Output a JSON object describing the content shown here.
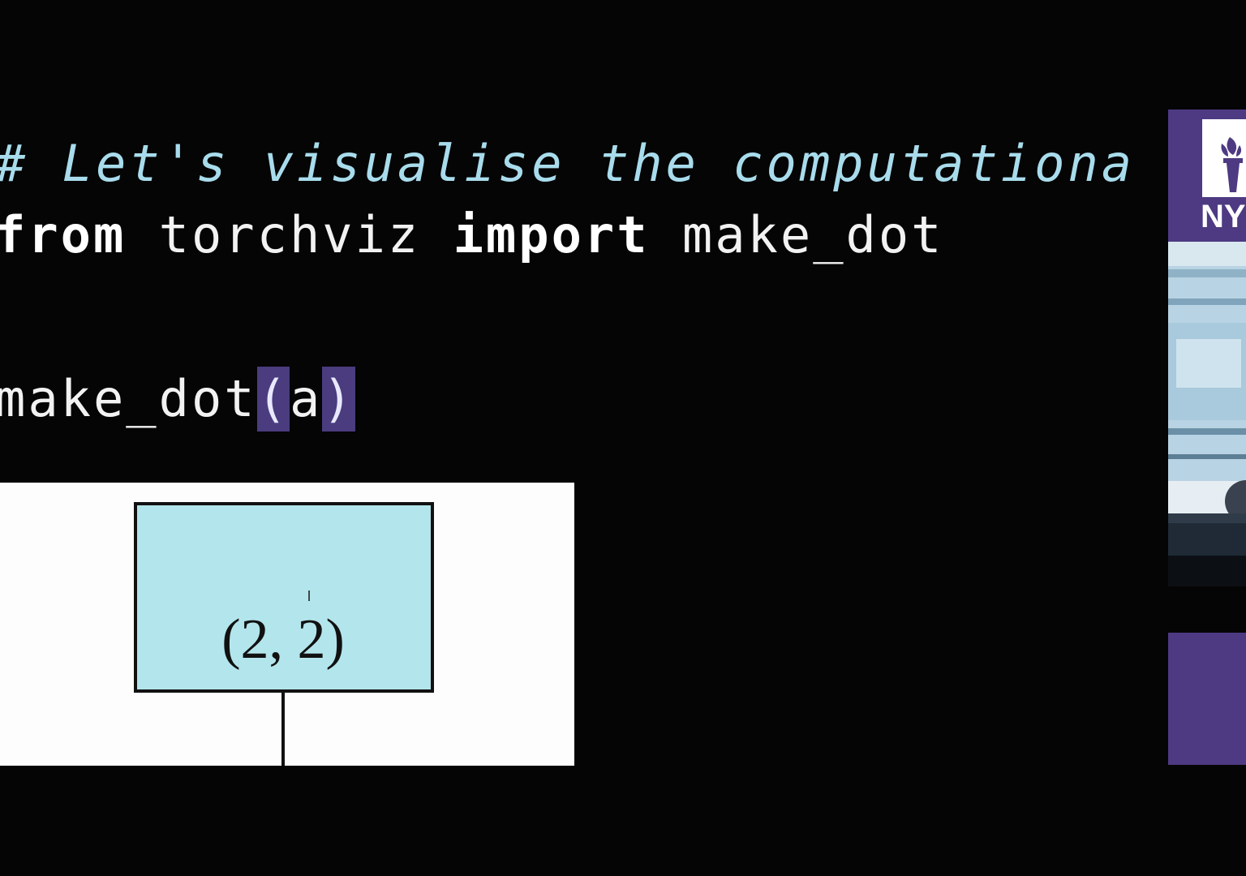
{
  "code": {
    "comment": "# Let's visualise the computationa",
    "import_line": {
      "kw_from": "from",
      "module": " torchviz ",
      "kw_import": "import",
      "name": " make_dot"
    },
    "call_line": {
      "func": "make_dot",
      "open_paren": "(",
      "arg": "a",
      "close_paren": ")"
    }
  },
  "graph": {
    "node_label": "(2, 2)",
    "node_fill": "#b3e5ec"
  },
  "sidebar": {
    "logo_text": "NY"
  },
  "colors": {
    "background": "#050505",
    "comment": "#a8dcec",
    "bracket_highlight": "#4a3c7e",
    "nyu_purple": "#4d3a82"
  }
}
